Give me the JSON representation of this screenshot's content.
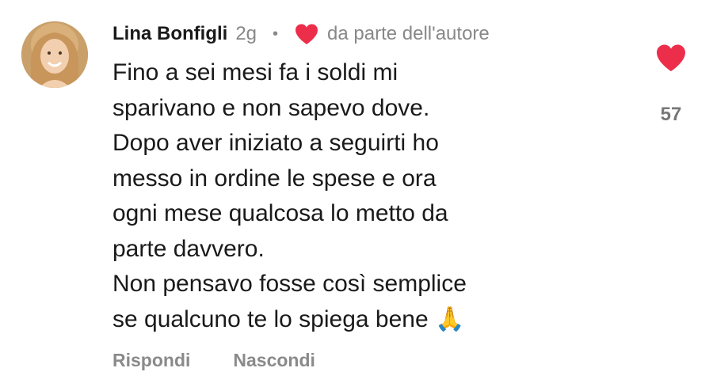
{
  "comment": {
    "author": "Lina Bonfigli",
    "time": "2g",
    "separator": "•",
    "author_like_label": "da parte dell'autore",
    "text": "Fino a sei mesi fa i soldi mi\nsparivano e non sapevo dove.\nDopo aver iniziato a seguirti ho\nmesso in ordine le spese e ora\nogni mese qualcosa lo metto da\nparte davvero.\nNon pensavo fosse così semplice\nse qualcuno te lo spiega bene 🙏",
    "like_count": "57"
  },
  "actions": {
    "reply": "Rispondi",
    "hide": "Nascondi"
  },
  "icons": {
    "author_heart": "heart-icon",
    "like_heart": "heart-icon"
  },
  "colors": {
    "heart": "#ec2e4a",
    "muted_text": "#888888"
  }
}
